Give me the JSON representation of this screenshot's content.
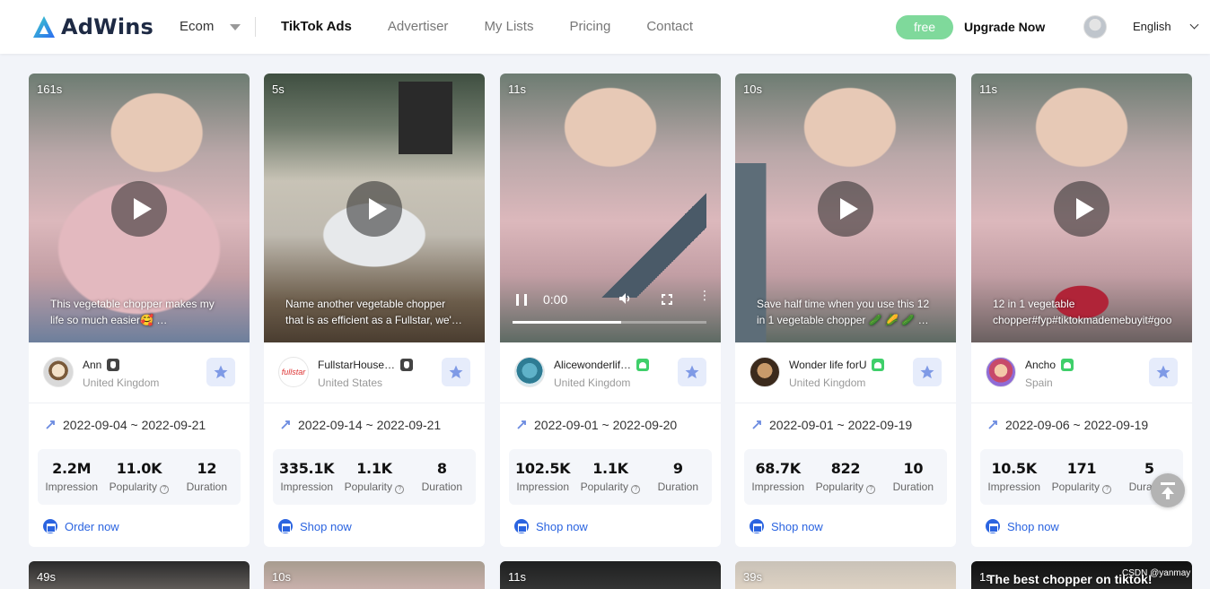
{
  "header": {
    "brand": "AdWins",
    "category": "Ecom",
    "nav": [
      "TikTok Ads",
      "Advertiser",
      "My Lists",
      "Pricing",
      "Contact"
    ],
    "plan": "free",
    "upgrade": "Upgrade Now",
    "language": "English"
  },
  "colors": {
    "accent": "#2b64e0",
    "free": "#7fd99b",
    "fav_bg": "#e6ecfb"
  },
  "cards": [
    {
      "duration": "161s",
      "caption": "This vegetable chopper makes my life so much easier🥰 …",
      "name": "Ann",
      "platform": "ios",
      "country": "United Kingdom",
      "dates": "2022-09-04 ~ 2022-09-21",
      "impression": "2.2M",
      "popularity": "11.0K",
      "duration_val": "12",
      "cta": "Order now"
    },
    {
      "duration": "5s",
      "caption": "Name another vegetable chopper that is as efficient as a Fullstar, we'…",
      "name": "FullstarHouse…",
      "platform": "ios",
      "country": "United States",
      "dates": "2022-09-14 ~ 2022-09-21",
      "impression": "335.1K",
      "popularity": "1.1K",
      "duration_val": "8",
      "cta": "Shop now"
    },
    {
      "duration": "11s",
      "caption": "",
      "player_time": "0:00",
      "name": "Alicewonderlif…",
      "platform": "android",
      "country": "United Kingdom",
      "dates": "2022-09-01 ~ 2022-09-20",
      "impression": "102.5K",
      "popularity": "1.1K",
      "duration_val": "9",
      "cta": "Shop now"
    },
    {
      "duration": "10s",
      "caption": "Save half time when you use this 12 in 1 vegetable chopper 🥒 🌽 🥒 …",
      "name": "Wonder life forU",
      "platform": "android",
      "country": "United Kingdom",
      "dates": "2022-09-01 ~ 2022-09-19",
      "impression": "68.7K",
      "popularity": "822",
      "duration_val": "10",
      "cta": "Shop now"
    },
    {
      "duration": "11s",
      "caption": "12 in 1 vegetable chopper#fyp#tiktokmademebuyit#goo",
      "name": "Ancho",
      "platform": "android",
      "country": "Spain",
      "dates": "2022-09-06 ~ 2022-09-19",
      "impression": "10.5K",
      "popularity": "171",
      "duration_val": "5",
      "cta": "Shop now"
    }
  ],
  "labels": {
    "impression": "Impression",
    "popularity": "Popularity",
    "duration": "Duration"
  },
  "bottom_row": [
    "49s",
    "10s",
    "11s",
    "39s",
    "1s"
  ],
  "bottom_caption": "The best chopper on tiktok!",
  "watermark": "CSDN @yanmay"
}
